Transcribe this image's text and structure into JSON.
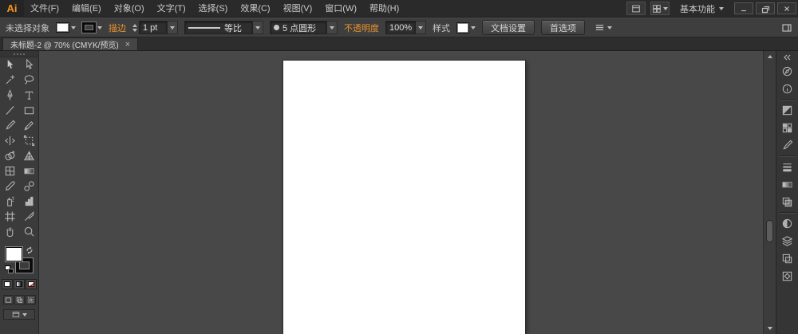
{
  "colors": {
    "accent_orange": "#e8922d",
    "ui_dark": "#3a3a3a",
    "canvas_gray": "#484848",
    "artboard_white": "#ffffff"
  },
  "menubar": {
    "logo": "Ai",
    "items": [
      {
        "label": "文件(F)"
      },
      {
        "label": "编辑(E)"
      },
      {
        "label": "对象(O)"
      },
      {
        "label": "文字(T)"
      },
      {
        "label": "选择(S)"
      },
      {
        "label": "效果(C)"
      },
      {
        "label": "视图(V)"
      },
      {
        "label": "窗口(W)"
      },
      {
        "label": "帮助(H)"
      }
    ],
    "workspace": "基本功能"
  },
  "controlbar": {
    "selection_status": "未选择对象",
    "stroke_label": "描边",
    "stroke_weight": "1 pt",
    "width_profile": "等比",
    "brush": "5 点圆形",
    "opacity_label": "不透明度",
    "opacity_value": "100%",
    "style_label": "样式",
    "document_setup": "文档设置",
    "preferences": "首选项"
  },
  "tabbar": {
    "tab_title": "未标题-2 @ 70% (CMYK/预览)",
    "close_label": "×"
  },
  "toolbar": {
    "tools": [
      {
        "name": "selection-tool",
        "icon": "selection"
      },
      {
        "name": "direct-selection-tool",
        "icon": "direct-selection"
      },
      {
        "name": "magic-wand-tool",
        "icon": "magic-wand"
      },
      {
        "name": "lasso-tool",
        "icon": "lasso"
      },
      {
        "name": "pen-tool",
        "icon": "pen"
      },
      {
        "name": "type-tool",
        "icon": "type"
      },
      {
        "name": "line-segment-tool",
        "icon": "line"
      },
      {
        "name": "rectangle-tool",
        "icon": "rectangle"
      },
      {
        "name": "paintbrush-tool",
        "icon": "paintbrush"
      },
      {
        "name": "pencil-tool",
        "icon": "pencil"
      },
      {
        "name": "width-tool",
        "icon": "width"
      },
      {
        "name": "free-transform-tool",
        "icon": "free-transform"
      },
      {
        "name": "shape-builder-tool",
        "icon": "shape-builder"
      },
      {
        "name": "perspective-grid-tool",
        "icon": "perspective"
      },
      {
        "name": "mesh-tool",
        "icon": "mesh"
      },
      {
        "name": "gradient-tool",
        "icon": "gradient"
      },
      {
        "name": "eyedropper-tool",
        "icon": "eyedropper"
      },
      {
        "name": "blend-tool",
        "icon": "blend"
      },
      {
        "name": "symbol-sprayer-tool",
        "icon": "symbol-sprayer"
      },
      {
        "name": "column-graph-tool",
        "icon": "column-graph"
      },
      {
        "name": "artboard-tool",
        "icon": "artboard"
      },
      {
        "name": "slice-tool",
        "icon": "slice"
      },
      {
        "name": "hand-tool",
        "icon": "hand"
      },
      {
        "name": "zoom-tool",
        "icon": "zoom"
      }
    ]
  },
  "panel_dock": {
    "items": [
      {
        "name": "panel-navigator",
        "icon": "compass",
        "separator_after": false
      },
      {
        "name": "panel-info",
        "icon": "info",
        "separator_after": true
      },
      {
        "name": "panel-color",
        "icon": "color",
        "separator_after": false
      },
      {
        "name": "panel-swatches",
        "icon": "swatches",
        "separator_after": false
      },
      {
        "name": "panel-brushes",
        "icon": "paintbrush",
        "separator_after": true
      },
      {
        "name": "panel-stroke",
        "icon": "stroke-lines",
        "separator_after": false
      },
      {
        "name": "panel-gradient",
        "icon": "gradient",
        "separator_after": false
      },
      {
        "name": "panel-transparency",
        "icon": "transparency",
        "separator_after": true
      },
      {
        "name": "panel-appearance",
        "icon": "appearance",
        "separator_after": false
      },
      {
        "name": "panel-layers",
        "icon": "layers",
        "separator_after": false
      },
      {
        "name": "panel-artboards",
        "icon": "artboards",
        "separator_after": false
      },
      {
        "name": "panel-symbols",
        "icon": "symbols",
        "separator_after": false
      }
    ]
  }
}
